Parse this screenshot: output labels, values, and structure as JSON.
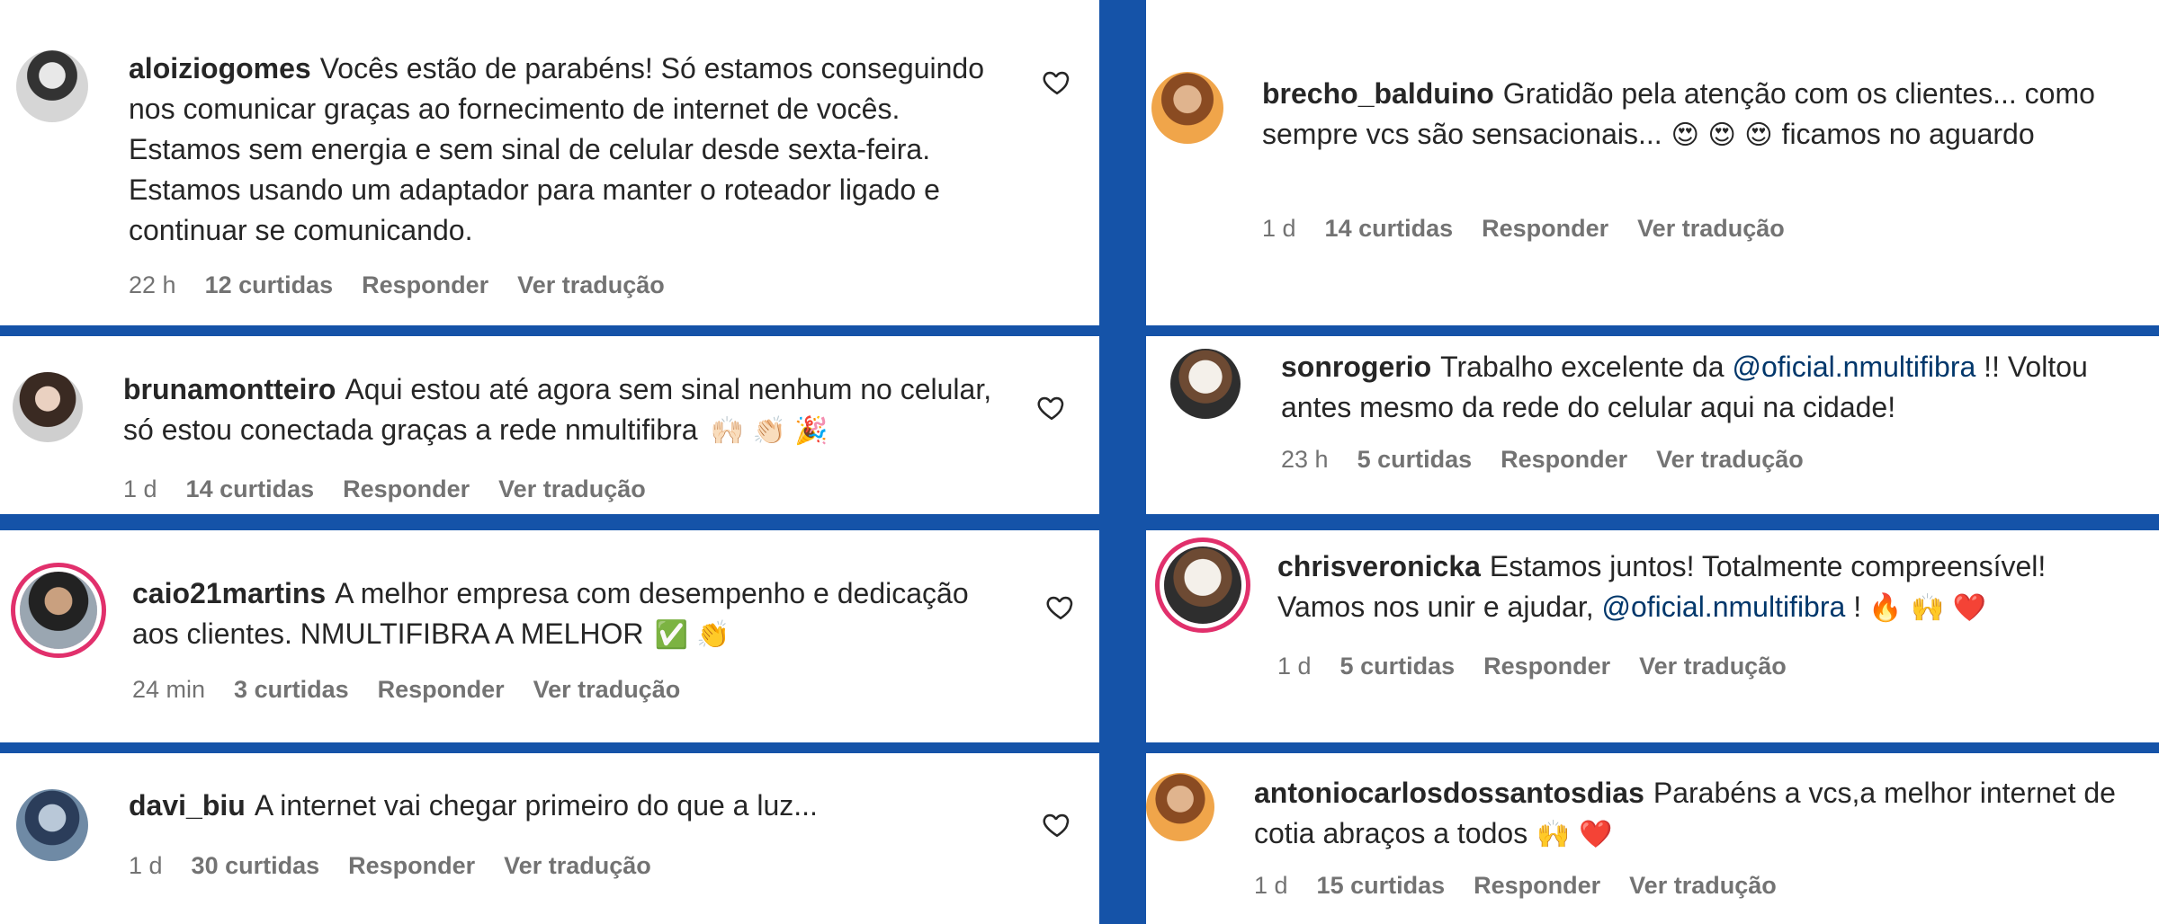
{
  "comments": [
    {
      "user": "aloiziogomes",
      "text": "Vocês estão de parabéns! Só estamos conseguindo nos comunicar graças ao fornecimento de internet de vocês. Estamos sem energia e sem sinal de celular desde sexta-feira. Estamos usando um adaptador para manter o roteador ligado e continuar se comunicando.",
      "time": "22 h",
      "likes": "12 curtidas",
      "reply": "Responder",
      "translate": "Ver tradução"
    },
    {
      "user": "brecho_balduino",
      "text": "Gratidão pela atenção com os clientes... como sempre vcs são sensacionais...",
      "emoji": "😍 😍 😍",
      "text_after": "ficamos no aguardo",
      "time": "1 d",
      "likes": "14 curtidas",
      "reply": "Responder",
      "translate": "Ver tradução"
    },
    {
      "user": "brunamontteiro",
      "text": "Aqui estou até agora sem sinal nenhum no celular, só estou conectada graças a rede nmultifibra",
      "emoji": "🙌🏻 👏🏻 🎉",
      "time": "1 d",
      "likes": "14 curtidas",
      "reply": "Responder",
      "translate": "Ver tradução"
    },
    {
      "user": "sonrogerio",
      "text_before": "Trabalho excelente da",
      "mention": "@oficial.nmultifibra",
      "text_after": "!! Voltou antes mesmo da rede do celular aqui na cidade!",
      "time": "23 h",
      "likes": "5 curtidas",
      "reply": "Responder",
      "translate": "Ver tradução"
    },
    {
      "user": "caio21martins",
      "text": "A melhor empresa com desempenho e dedicação aos clientes. NMULTIFIBRA A MELHOR",
      "emoji": "✅ 👏",
      "time": "24 min",
      "likes": "3 curtidas",
      "reply": "Responder",
      "translate": "Ver tradução"
    },
    {
      "user": "chrisveronicka",
      "text_before": "Estamos juntos! Totalmente compreensível! Vamos nos unir e ajudar,",
      "mention": "@oficial.nmultifibra",
      "text_after": "!",
      "emoji": "🔥 🙌 ❤️",
      "time": "1 d",
      "likes": "5 curtidas",
      "reply": "Responder",
      "translate": "Ver tradução"
    },
    {
      "user": "davi_biu",
      "text": "A internet vai chegar primeiro do que a luz...",
      "time": "1 d",
      "likes": "30 curtidas",
      "reply": "Responder",
      "translate": "Ver tradução"
    },
    {
      "user": "antoniocarlosdossantosdias",
      "text": "Parabéns a vcs,a melhor internet de cotia abraços a todos",
      "emoji": "🙌 ❤️",
      "time": "1 d",
      "likes": "15 curtidas",
      "reply": "Responder",
      "translate": "Ver tradução"
    }
  ],
  "colors": {
    "background": "#1553a8",
    "mention": "#00376b",
    "meta": "#737373"
  },
  "icons": {
    "like": "heart-outline-icon"
  }
}
